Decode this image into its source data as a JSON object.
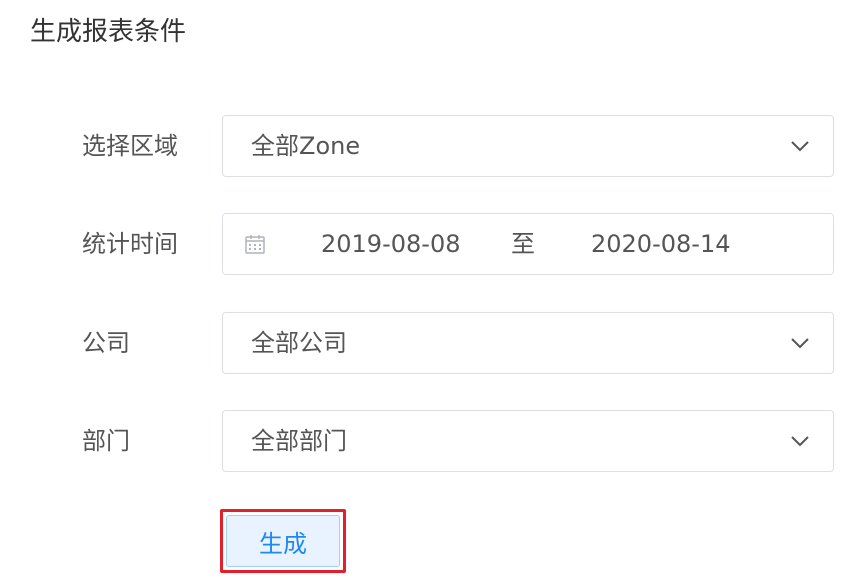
{
  "title": "生成报表条件",
  "form": {
    "zone": {
      "label": "选择区域",
      "value": "全部Zone",
      "icon": "chevron-down-icon"
    },
    "period": {
      "label": "统计时间",
      "start": "2019-08-08",
      "separator": "至",
      "end": "2020-08-14",
      "icon": "calendar-icon"
    },
    "company": {
      "label": "公司",
      "value": "全部公司",
      "icon": "chevron-down-icon"
    },
    "department": {
      "label": "部门",
      "value": "全部部门",
      "icon": "chevron-down-icon"
    }
  },
  "actions": {
    "generate_label": "生成"
  },
  "colors": {
    "primary": "#1e88f5",
    "button_bg": "#e8f3ff",
    "highlight_border": "#e0202a",
    "input_border": "#dcdfe6"
  }
}
